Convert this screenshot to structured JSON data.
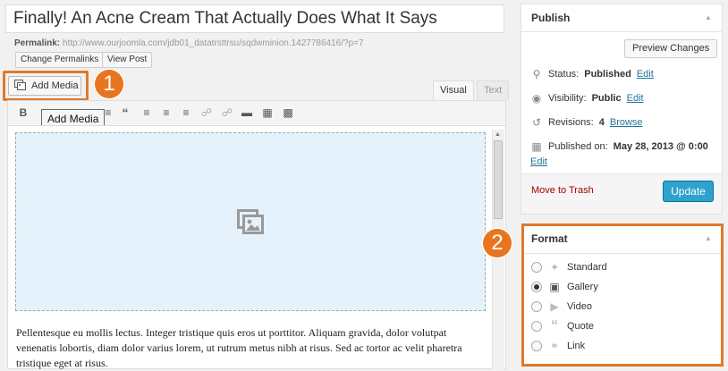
{
  "post": {
    "title": "Finally! An Acne Cream That Actually Does What It Says",
    "permalink_label": "Permalink:",
    "permalink_url": "http://www.ourjoomla.com/jdb01_datatrsttrsu/sqdwminion.1427786416/?p=7",
    "change_permalinks": "Change Permalinks",
    "view_post": "View Post"
  },
  "editor": {
    "add_media": "Add Media",
    "tooltip": "Add Media",
    "tab_visual": "Visual",
    "tab_text": "Text",
    "toolbar": [
      "B",
      "I",
      "ABC",
      "list",
      "list-ol",
      "quote",
      "align-left",
      "align-center",
      "align-right",
      "link",
      "unlink",
      "more",
      "fullscreen",
      "kitchen-sink"
    ],
    "body_text": "Pellentesque eu mollis lectus. Integer tristique quis eros ut porttitor. Aliquam gravida, dolor volutpat venenatis lobortis, diam dolor varius lorem, ut rutrum metus nibh at risus. Sed ac tortor ac velit pharetra tristique eget at risus."
  },
  "steps": {
    "one": "1",
    "two": "2"
  },
  "publish": {
    "title": "Publish",
    "preview_button": "Preview Changes",
    "status_label": "Status:",
    "status_value": "Published",
    "visibility_label": "Visibility:",
    "visibility_value": "Public",
    "revisions_label": "Revisions:",
    "revisions_value": "4",
    "browse": "Browse",
    "published_label": "Published on:",
    "published_value": "May 28, 2013 @ 0:00",
    "edit": "Edit",
    "trash": "Move to Trash",
    "update": "Update"
  },
  "format": {
    "title": "Format",
    "options": [
      {
        "label": "Standard",
        "icon": "pin-icon",
        "checked": false
      },
      {
        "label": "Gallery",
        "icon": "gallery-icon",
        "checked": true
      },
      {
        "label": "Video",
        "icon": "video-icon",
        "checked": false
      },
      {
        "label": "Quote",
        "icon": "quote-icon",
        "checked": false
      },
      {
        "label": "Link",
        "icon": "link-icon",
        "checked": false
      }
    ]
  },
  "colors": {
    "accent": "#e07a2a",
    "update": "#2ea2cc",
    "link": "#21759b",
    "trash": "#aa0000"
  }
}
